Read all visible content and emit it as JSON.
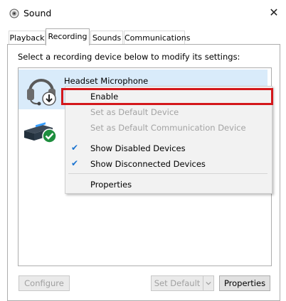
{
  "window": {
    "title": "Sound",
    "close_glyph": "✕"
  },
  "tabs": [
    {
      "label": "Playback",
      "active": false
    },
    {
      "label": "Recording",
      "active": true
    },
    {
      "label": "Sounds",
      "active": false
    },
    {
      "label": "Communications",
      "active": false
    }
  ],
  "recording": {
    "instruction": "Select a recording device below to modify its settings:",
    "devices": [
      {
        "name": "Headset Microphone",
        "icon": "headset-icon",
        "status_icon": "down-arrow-disabled-icon",
        "selected": true
      },
      {
        "name": "",
        "icon": "microphone-device-icon",
        "status_icon": "green-check-icon",
        "selected": false
      }
    ]
  },
  "context_menu": {
    "items": [
      {
        "label": "Enable",
        "enabled": true,
        "checked": false,
        "highlighted": true
      },
      {
        "label": "Set as Default Device",
        "enabled": false,
        "checked": false
      },
      {
        "label": "Set as Default Communication Device",
        "enabled": false,
        "checked": false
      },
      {
        "label": "Show Disabled Devices",
        "enabled": true,
        "checked": true
      },
      {
        "label": "Show Disconnected Devices",
        "enabled": true,
        "checked": true
      },
      {
        "label": "Properties",
        "enabled": true,
        "checked": false
      }
    ],
    "check_glyph": "✔"
  },
  "buttons": {
    "configure": "Configure",
    "set_default": "Set Default",
    "properties": "Properties"
  },
  "colors": {
    "selection": "#d9ebfa",
    "highlight_border": "#d4171b",
    "check": "#1a73d0",
    "status_ok": "#1e8e3e"
  }
}
